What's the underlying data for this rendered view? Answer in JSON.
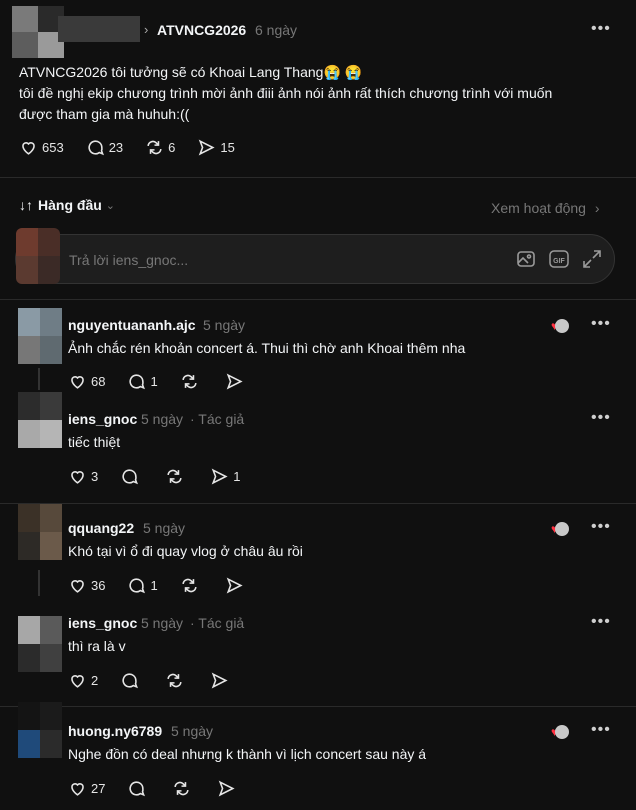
{
  "post": {
    "author": "ATVNCG2026",
    "time": "6 ngày",
    "line1": "ATVNCG2026 tôi tưởng sẽ có Khoai Lang Thang😭 😭",
    "line2": "tôi đề nghị ekip chương trình mời ảnh điii ảnh nói ảnh rất thích chương trình với muốn",
    "line3": "được tham gia mà huhuh:((",
    "likes": "653",
    "comments": "23",
    "reposts": "6",
    "shares": "15"
  },
  "sort": {
    "label": "Hàng đầu",
    "activity": "Xem hoạt động"
  },
  "reply": {
    "placeholder": "Trả lời iens_gnoc..."
  },
  "comments": [
    {
      "name": "nguyentuananh.ajc",
      "time": "5 ngày",
      "text": "Ảnh chắc rén khoản concert á. Thui thì chờ anh Khoai thêm nha",
      "likes": "68",
      "comments": "1",
      "shares": ""
    },
    {
      "name": "iens_gnoc",
      "time": "5 ngày",
      "tag": "· Tác giả",
      "text": "tiếc thiệt",
      "likes": "3",
      "comments": "",
      "shares": "1"
    },
    {
      "name": "qquang22",
      "time": "5 ngày",
      "text": "Khó tại vì ổ đi quay vlog ở châu âu rồi",
      "likes": "36",
      "comments": "1",
      "shares": ""
    },
    {
      "name": "iens_gnoc",
      "time": "5 ngày",
      "tag": "· Tác giả",
      "text": "thì ra là v",
      "likes": "2",
      "comments": "",
      "shares": ""
    },
    {
      "name": "huong.ny6789",
      "time": "5 ngày",
      "text": "Nghe đồn có deal nhưng k thành vì lịch concert sau này á",
      "likes": "27",
      "comments": "",
      "shares": ""
    }
  ],
  "colors": {
    "background": "#101010",
    "heart": "#ff3040",
    "muted": "#777777"
  }
}
